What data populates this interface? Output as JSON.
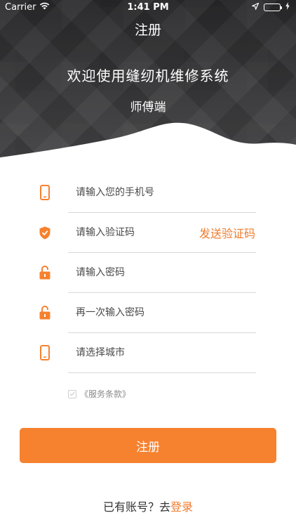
{
  "status_bar": {
    "carrier": "Carrier",
    "time": "1:41 PM"
  },
  "nav": {
    "title": "注册"
  },
  "hero": {
    "welcome": "欢迎使用缝纫机维修系统",
    "subtitle": "师傅端"
  },
  "form": {
    "phone_placeholder": "请输入您的手机号",
    "code_placeholder": "请输入验证码",
    "send_code_label": "发送验证码",
    "password_placeholder": "请输入密码",
    "confirm_password_placeholder": "再一次输入密码",
    "city_placeholder": "请选择城市"
  },
  "terms": {
    "label": "《服务条款》",
    "checked": true
  },
  "register_button": {
    "label": "注册"
  },
  "login_prompt": {
    "text": "已有账号？去",
    "link": "登录"
  },
  "colors": {
    "accent": "#f6812f",
    "header_dark": "#2c2c2e",
    "battery": "#4cd964"
  },
  "icons": [
    "wifi-icon",
    "location-arrow-icon",
    "battery-icon",
    "charging-bolt-icon",
    "phone-icon",
    "shield-check-icon",
    "lock-icon",
    "phone-icon"
  ]
}
